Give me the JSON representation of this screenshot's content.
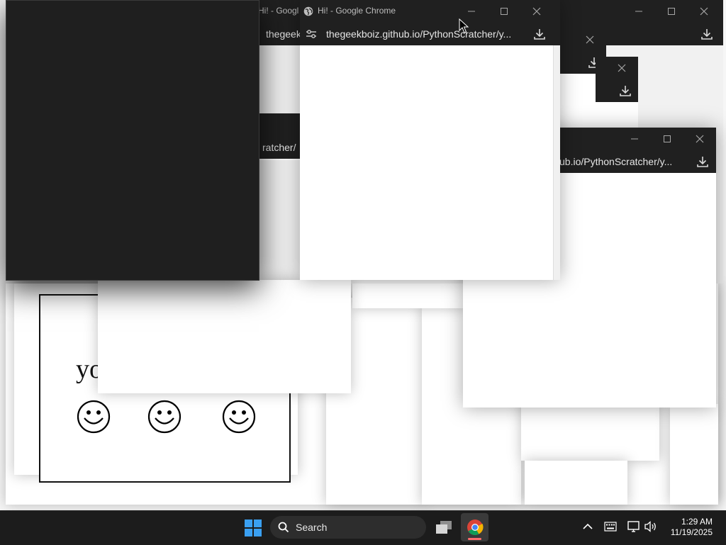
{
  "windows": {
    "front": {
      "title": "Hi! - Google Chrome",
      "url": "thegeekboiz.github.io/PythonScratcher/y..."
    },
    "right": {
      "url": "ub.io/PythonScratcher/y..."
    },
    "mid_left": {
      "url": "ratcher/"
    },
    "back_top": {
      "title": "Hi! - Googl",
      "url": "thegeek"
    },
    "bottom_left": {
      "text": "yo"
    }
  },
  "taskbar": {
    "search_placeholder": "Search",
    "time": "1:29 AM",
    "date": "11/19/2025"
  },
  "icons": [
    "windows-logo-icon",
    "search-icon",
    "task-view-icon",
    "chrome-icon",
    "chevron-up-icon",
    "keyboard-icon",
    "network-icon",
    "volume-icon",
    "download-icon",
    "minimize-icon",
    "maximize-icon",
    "close-icon",
    "globe-icon",
    "site-settings-icon",
    "smiley-icon",
    "mouse-cursor-icon"
  ],
  "colors": {
    "titlebar": "#202020",
    "taskbar": "#1c1c1c",
    "desktop": "#f6f6f6",
    "dark_window": "#1f1f1f"
  }
}
